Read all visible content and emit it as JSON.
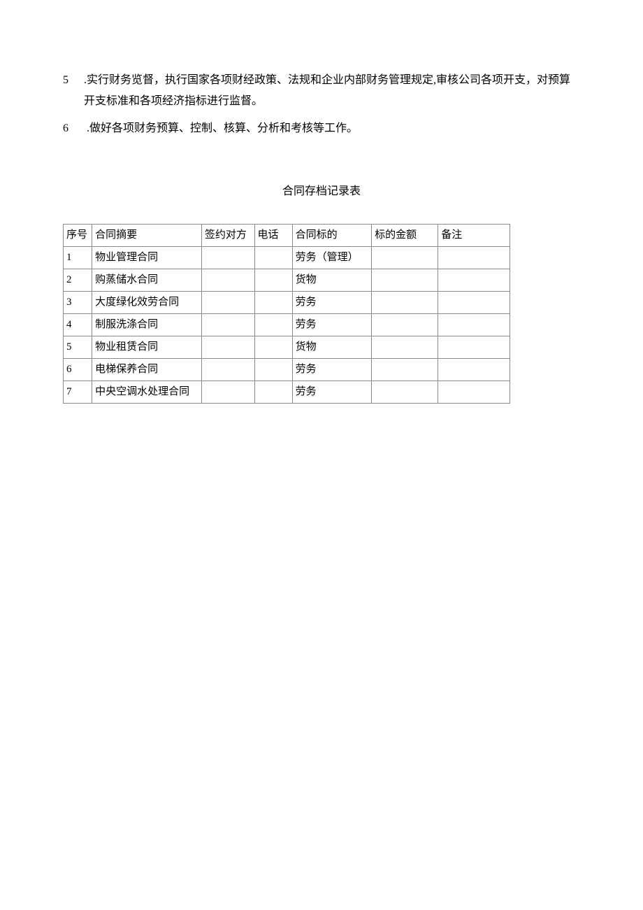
{
  "paragraphs": [
    {
      "num": "5",
      "text": ".实行财务览督，执行国家各项财经政策、法规和企业内部财务管理规定,审核公司各项开支，对预算",
      "cont": "开支标准和各项经济指标进行监督。"
    },
    {
      "num": "6",
      "text": "  .做好各项财务预算、控制、核算、分析和考核等工作。",
      "cont": ""
    }
  ],
  "tableTitle": "合同存档记录表",
  "headers": {
    "seq": "序号",
    "summary": "合同摘要",
    "party": "签约对方",
    "phone": "电话",
    "subject": "合同标的",
    "amount": "标的金额",
    "remark": "备注"
  },
  "rows": [
    {
      "seq": "1",
      "summary": "物业管理合同",
      "party": "",
      "phone": "",
      "subject": "劳务（管理）",
      "amount": "",
      "remark": ""
    },
    {
      "seq": "2",
      "summary": "购蒸储水合同",
      "party": "",
      "phone": "",
      "subject": "货物",
      "amount": "",
      "remark": ""
    },
    {
      "seq": "3",
      "summary": "大度绿化效劳合同",
      "party": "",
      "phone": "",
      "subject": "劳务",
      "amount": "",
      "remark": ""
    },
    {
      "seq": "4",
      "summary": "制服洗涤合同",
      "party": "",
      "phone": "",
      "subject": "劳务",
      "amount": "",
      "remark": ""
    },
    {
      "seq": "5",
      "summary": "物业租赁合同",
      "party": "",
      "phone": "",
      "subject": "货物",
      "amount": "",
      "remark": ""
    },
    {
      "seq": "6",
      "summary": "电梯保养合同",
      "party": "",
      "phone": "",
      "subject": "劳务",
      "amount": "",
      "remark": ""
    },
    {
      "seq": "7",
      "summary": "中央空调水处理合同",
      "party": "",
      "phone": "",
      "subject": "劳务",
      "amount": "",
      "remark": ""
    }
  ]
}
